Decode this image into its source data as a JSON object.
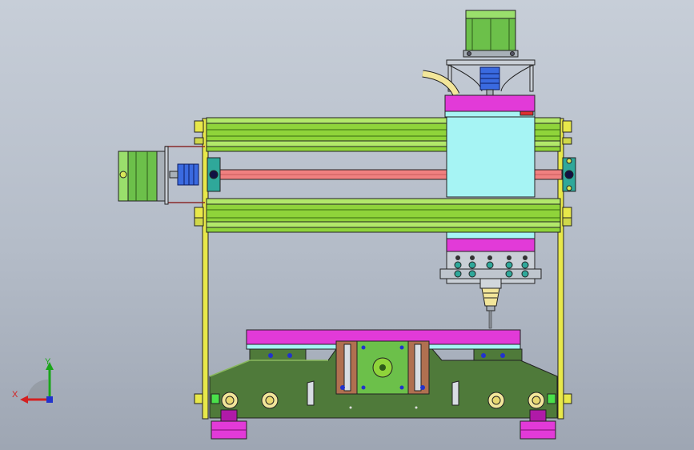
{
  "view": {
    "background_top": "#c7ced8",
    "background_bottom": "#9ea6b3"
  },
  "triad": {
    "x_label": "X",
    "y_label": "Y",
    "x_color": "#d42020",
    "y_color": "#1aa51a",
    "z_color": "#2233cc"
  },
  "colors": {
    "rail_green": "#8fd43a",
    "rail_dark": "#3a6a10",
    "leadscrew": "#f08080",
    "spindle_block": "#a6f4f4",
    "magenta": "#e23ad8",
    "motor_green": "#6cc04a",
    "base_green": "#4f7a3a",
    "base_light": "#8ab85e",
    "frame_yellow": "#e8e84a",
    "coupler_blue": "#3a6ae0",
    "copper": "#b07050"
  }
}
